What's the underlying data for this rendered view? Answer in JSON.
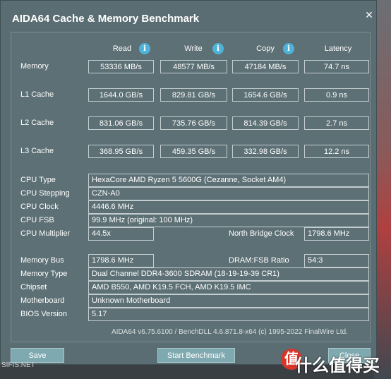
{
  "window": {
    "title": "AIDA64 Cache & Memory Benchmark",
    "close_glyph": "✕"
  },
  "columns": {
    "read": "Read",
    "write": "Write",
    "copy": "Copy",
    "latency": "Latency",
    "info_glyph": "i"
  },
  "rows": {
    "memory": {
      "label": "Memory",
      "read": "53336 MB/s",
      "write": "48577 MB/s",
      "copy": "47184 MB/s",
      "latency": "74.7 ns"
    },
    "l1": {
      "label": "L1 Cache",
      "read": "1644.0 GB/s",
      "write": "829.81 GB/s",
      "copy": "1654.6 GB/s",
      "latency": "0.9 ns"
    },
    "l2": {
      "label": "L2 Cache",
      "read": "831.06 GB/s",
      "write": "735.76 GB/s",
      "copy": "814.39 GB/s",
      "latency": "2.7 ns"
    },
    "l3": {
      "label": "L3 Cache",
      "read": "368.95 GB/s",
      "write": "459.35 GB/s",
      "copy": "332.98 GB/s",
      "latency": "12.2 ns"
    }
  },
  "cpu": {
    "type_label": "CPU Type",
    "type": "HexaCore AMD Ryzen 5 5600G  (Cezanne, Socket AM4)",
    "stepping_label": "CPU Stepping",
    "stepping": "CZN-A0",
    "clock_label": "CPU Clock",
    "clock": "4446.6 MHz",
    "fsb_label": "CPU FSB",
    "fsb": "99.9 MHz  (original: 100 MHz)",
    "multiplier_label": "CPU Multiplier",
    "multiplier": "44.5x",
    "nb_clock_label": "North Bridge Clock",
    "nb_clock": "1798.6 MHz"
  },
  "memory_info": {
    "bus_label": "Memory Bus",
    "bus": "1798.6 MHz",
    "ratio_label": "DRAM:FSB Ratio",
    "ratio": "54:3",
    "type_label": "Memory Type",
    "type": "Dual Channel DDR4-3600 SDRAM  (18-19-19-39 CR1)",
    "chipset_label": "Chipset",
    "chipset": "AMD B550, AMD K19.5 FCH, AMD K19.5 IMC",
    "motherboard_label": "Motherboard",
    "motherboard": "Unknown Motherboard",
    "bios_label": "BIOS Version",
    "bios": "5.17"
  },
  "footer": "AIDA64 v6.75.6100 / BenchDLL 4.6.871.8-x64  (c) 1995-2022 FinalWire Ltd.",
  "buttons": {
    "save": "Save",
    "start": "Start Benchmark",
    "close": "Close"
  },
  "watermark": {
    "text": "什么值得买",
    "icon_glyph": "值",
    "small": "SIFIS.NET"
  }
}
